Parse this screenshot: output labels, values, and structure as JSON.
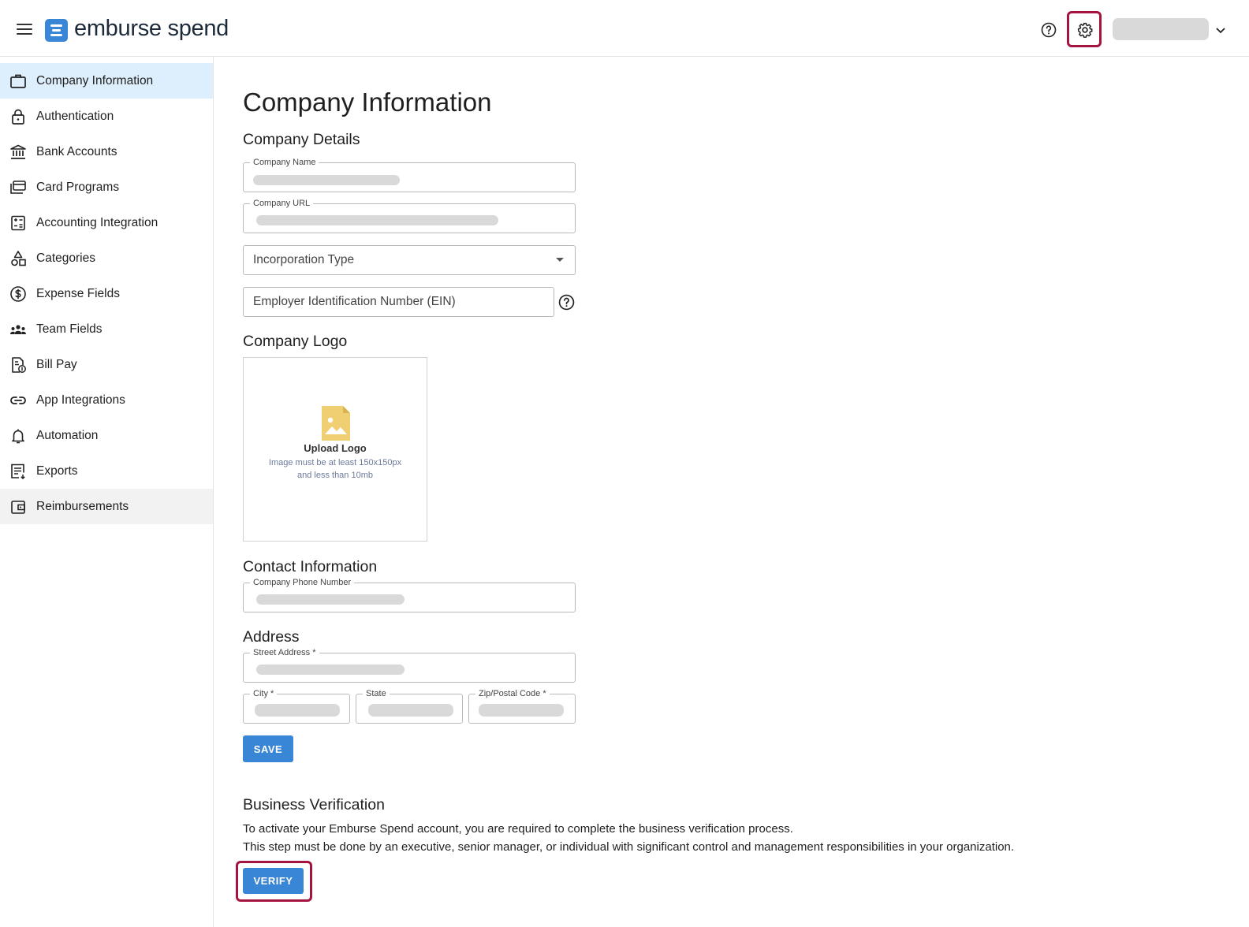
{
  "header": {
    "brand_bold": "emburse",
    "brand_light": " spend",
    "icons": {
      "menu": "hamburger-icon",
      "help": "help-circle-icon",
      "settings": "gear-icon",
      "account_caret": "chevron-down-icon"
    }
  },
  "sidebar": {
    "items": [
      {
        "label": "Company Information",
        "icon": "briefcase-icon"
      },
      {
        "label": "Authentication",
        "icon": "lock-icon"
      },
      {
        "label": "Bank Accounts",
        "icon": "bank-icon"
      },
      {
        "label": "Card Programs",
        "icon": "cards-icon"
      },
      {
        "label": "Accounting Integration",
        "icon": "calculator-icon"
      },
      {
        "label": "Categories",
        "icon": "shapes-icon"
      },
      {
        "label": "Expense Fields",
        "icon": "dollar-circle-icon"
      },
      {
        "label": "Team Fields",
        "icon": "team-icon"
      },
      {
        "label": "Bill Pay",
        "icon": "bill-icon"
      },
      {
        "label": "App Integrations",
        "icon": "link-icon"
      },
      {
        "label": "Automation",
        "icon": "bell-icon"
      },
      {
        "label": "Exports",
        "icon": "export-list-icon"
      },
      {
        "label": "Reimbursements",
        "icon": "wallet-icon"
      }
    ]
  },
  "main": {
    "title": "Company Information",
    "details": {
      "heading": "Company Details",
      "company_name_label": "Company Name",
      "company_url_label": "Company URL",
      "incorporation_placeholder": "Incorporation Type",
      "ein_placeholder": "Employer Identification Number (EIN)"
    },
    "logo": {
      "heading": "Company Logo",
      "upload_title": "Upload Logo",
      "upload_hint_1": "Image must be at least 150x150px",
      "upload_hint_2": "and less than 10mb"
    },
    "contact": {
      "heading": "Contact Information",
      "phone_label": "Company Phone Number"
    },
    "address": {
      "heading": "Address",
      "street_label": "Street Address *",
      "city_label": "City *",
      "state_label": "State",
      "zip_label": "Zip/Postal Code *"
    },
    "save_label": "SAVE",
    "verification": {
      "heading": "Business Verification",
      "line1": "To activate your Emburse Spend account, you are required to complete the business verification process.",
      "line2": "This step must be done by an executive, senior manager, or individual with significant control and management responsibilities in your organization.",
      "verify_label": "VERIFY"
    }
  },
  "colors": {
    "accent": "#3a86d6",
    "highlight_border": "#a5133f",
    "active_nav_bg": "#ddeefc",
    "logo_icon": "#f0cf72"
  }
}
